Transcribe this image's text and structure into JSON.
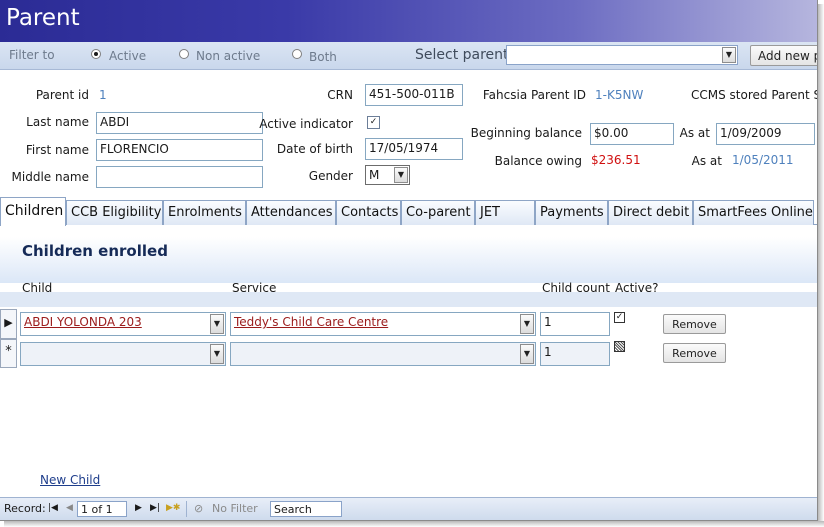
{
  "form": {
    "title": "Parent"
  },
  "filter": {
    "label": "Filter to",
    "options": [
      {
        "label": "Active",
        "selected": true
      },
      {
        "label": "Non active",
        "selected": false
      },
      {
        "label": "Both",
        "selected": false
      }
    ],
    "select_parent_label": "Select parent",
    "select_parent_value": "",
    "add_new_label": "Add new pa"
  },
  "parent": {
    "parent_id_label": "Parent id",
    "parent_id": "1",
    "last_name_label": "Last name",
    "last_name": "ABDI",
    "first_name_label": "First name",
    "first_name": "FLORENCIO",
    "middle_name_label": "Middle name",
    "middle_name": "",
    "crn_label": "CRN",
    "crn": "451-500-011B",
    "active_indicator_label": "Active indicator",
    "active_indicator_checked": true,
    "dob_label": "Date of birth",
    "dob": "17/05/1974",
    "gender_label": "Gender",
    "gender": "M",
    "fahcsia_label": "Fahcsia Parent ID",
    "fahcsia_id": "1-K5NW",
    "ccms_label": "CCMS stored Parent Ser",
    "beginning_balance_label": "Beginning balance",
    "beginning_balance": "$0.00",
    "as_at_label_1": "As at",
    "as_at_1": "1/09/2009",
    "balance_owing_label": "Balance owing",
    "balance_owing": "$236.51",
    "as_at_label_2": "As at",
    "as_at_2": "1/05/2011"
  },
  "tabs": [
    {
      "label": "Children",
      "active": true
    },
    {
      "label": "CCB Eligibility",
      "active": false
    },
    {
      "label": "Enrolments",
      "active": false
    },
    {
      "label": "Attendances",
      "active": false
    },
    {
      "label": "Contacts",
      "active": false
    },
    {
      "label": "Co-parent",
      "active": false
    },
    {
      "label": "JET",
      "active": false
    },
    {
      "label": "Payments",
      "active": false
    },
    {
      "label": "Direct debit",
      "active": false
    },
    {
      "label": "SmartFees Online",
      "active": false
    }
  ],
  "children": {
    "title": "Children enrolled",
    "columns": {
      "child": "Child",
      "service": "Service",
      "child_count": "Child count",
      "active": "Active?"
    },
    "rows": [
      {
        "selector": "▶",
        "child": "ABDI YOLONDA 203",
        "service": "Teddy's Child Care Centre",
        "child_count": "1",
        "active": true,
        "remove_label": "Remove"
      },
      {
        "selector": "*",
        "child": "",
        "service": "",
        "child_count": "1",
        "active": false,
        "remove_label": "Remove"
      }
    ],
    "new_child_label": "New Child"
  },
  "record_nav": {
    "record_label": "Record:",
    "position": "1 of 1",
    "no_filter_label": "No Filter",
    "search_label": "Search"
  },
  "colors": {
    "title_bar_start": "#2b2b95",
    "title_bar_end": "#b6b6de",
    "id_blue": "#4f81bd",
    "balance_red": "#d01010",
    "link_red": "#9b1b1b"
  }
}
